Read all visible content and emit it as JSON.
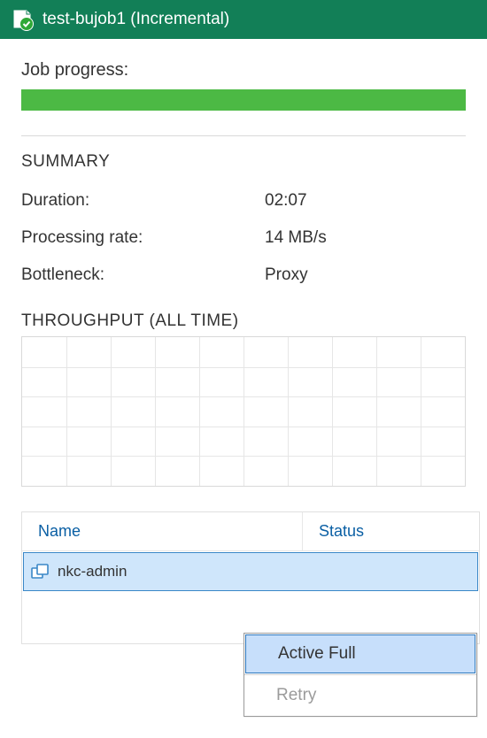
{
  "titlebar": {
    "title": "test-bujob1 (Incremental)"
  },
  "job_progress": {
    "label": "Job progress:",
    "percent": 100
  },
  "summary": {
    "heading": "SUMMARY",
    "rows": [
      {
        "label": "Duration:",
        "value": "02:07"
      },
      {
        "label": "Processing rate:",
        "value": "14 MB/s"
      },
      {
        "label": "Bottleneck:",
        "value": "Proxy"
      }
    ]
  },
  "throughput": {
    "heading": "THROUGHPUT (ALL TIME)"
  },
  "table": {
    "columns": {
      "name": "Name",
      "status": "Status"
    },
    "rows": [
      {
        "name": "nkc-admin",
        "status": ""
      }
    ]
  },
  "context_menu": {
    "items": [
      {
        "label": "Active Full",
        "enabled": true,
        "highlighted": true
      },
      {
        "label": "Retry",
        "enabled": false,
        "highlighted": false
      }
    ]
  }
}
